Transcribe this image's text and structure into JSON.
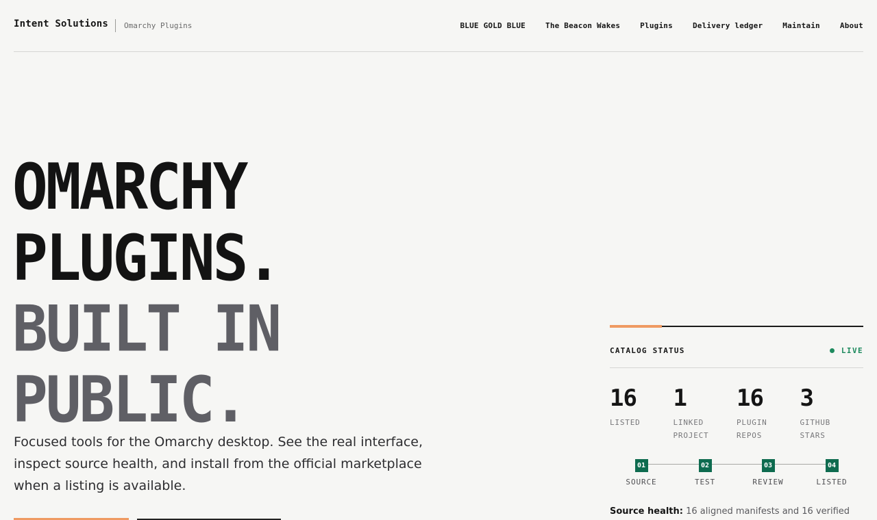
{
  "header": {
    "brand": "Intent Solutions",
    "subtitle": "Omarchy Plugins",
    "nav": [
      {
        "label": "BLUE GOLD BLUE"
      },
      {
        "label": "The Beacon Wakes"
      },
      {
        "label": "Plugins"
      },
      {
        "label": "Delivery ledger"
      },
      {
        "label": "Maintain"
      },
      {
        "label": "About"
      }
    ]
  },
  "hero": {
    "line1": "OMARCHY",
    "line2": "PLUGINS.",
    "line3": "BUILT IN",
    "line4": "PUBLIC.",
    "lede": "Focused tools for the Omarchy desktop. See the real interface, inspect source health, and install from the official marketplace when a listing is available."
  },
  "status": {
    "title": "CATALOG STATUS",
    "live": "LIVE",
    "stats": [
      {
        "value": "16",
        "label": "LISTED"
      },
      {
        "value": "1",
        "label": "LINKED PROJECT"
      },
      {
        "value": "16",
        "label": "PLUGIN REPOS"
      },
      {
        "value": "3",
        "label": "GITHUB STARS"
      }
    ],
    "steps": [
      {
        "num": "01",
        "label": "SOURCE"
      },
      {
        "num": "02",
        "label": "TEST"
      },
      {
        "num": "03",
        "label": "REVIEW"
      },
      {
        "num": "04",
        "label": "LISTED"
      }
    ],
    "health_label": "Source health:",
    "health_text": "16 aligned manifests and 16 verified"
  },
  "colors": {
    "accent": "#ef9a62",
    "live_green": "#1e8a5e",
    "step_green": "#0e6b4f",
    "hero_gray": "#5f5f65"
  }
}
